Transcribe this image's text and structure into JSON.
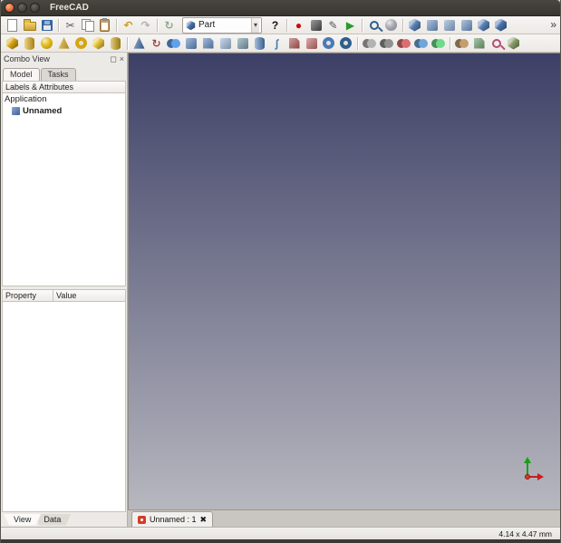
{
  "window": {
    "title": "FreeCAD"
  },
  "colors": {
    "chrome": "#d6d2cd",
    "viewport_top": "#3d4066",
    "viewport_bottom": "#b7b7bf",
    "axis_x": "#c81e1e",
    "axis_y": "#18a018"
  },
  "icons": {
    "caret": "▾",
    "overflow": "»",
    "panel_float": "◻",
    "panel_close": "×",
    "tab_close": "✖"
  },
  "toolbar_main": {
    "left_items": [
      {
        "name": "new-document",
        "kind": "page"
      },
      {
        "name": "open-document",
        "kind": "folder"
      },
      {
        "name": "save-document",
        "kind": "disk"
      },
      {
        "kind": "sep"
      },
      {
        "name": "cut",
        "kind": "glyph",
        "glyph": "✂",
        "color": "#5f5f5f"
      },
      {
        "name": "copy",
        "kind": "copy"
      },
      {
        "name": "paste",
        "kind": "clip"
      },
      {
        "kind": "sep"
      },
      {
        "name": "undo",
        "kind": "glyph",
        "glyph": "↶",
        "color": "#c79a1f",
        "bold": true
      },
      {
        "name": "redo",
        "kind": "glyph",
        "glyph": "↷",
        "color": "#b3afa9",
        "bold": true
      },
      {
        "kind": "sep"
      },
      {
        "name": "refresh",
        "kind": "glyph",
        "glyph": "↻",
        "color": "#8fa58f",
        "bold": true
      }
    ],
    "workbench_selector": {
      "value": "Part"
    },
    "right_items": [
      {
        "name": "whats-this",
        "kind": "glyph",
        "glyph": "?",
        "color": "#111111",
        "bold": true
      },
      {
        "kind": "sep"
      },
      {
        "name": "macro-record",
        "kind": "glyph",
        "glyph": "●",
        "color": "#c01010"
      },
      {
        "name": "macro-stop",
        "kind": "sq",
        "color": "#4a4a4a"
      },
      {
        "name": "macro-edit",
        "kind": "glyph",
        "glyph": "✎",
        "color": "#555555"
      },
      {
        "name": "macro-execute",
        "kind": "glyph",
        "glyph": "▶",
        "color": "#2a9a2a"
      },
      {
        "kind": "sep"
      },
      {
        "name": "zoom-fit-all",
        "kind": "zoom",
        "color": "#2e5f8a"
      },
      {
        "name": "draw-style",
        "kind": "sph",
        "color": "#a8a8b2"
      },
      {
        "kind": "sep"
      },
      {
        "name": "view-isometric",
        "kind": "cube",
        "color": "#5b82b8"
      },
      {
        "name": "view-front",
        "kind": "sq",
        "color": "#6f94c4"
      },
      {
        "name": "view-top",
        "kind": "sq",
        "color": "#87a8d0"
      },
      {
        "name": "view-right",
        "kind": "sq",
        "color": "#6f94c4"
      },
      {
        "name": "view-rear",
        "kind": "cube",
        "color": "#5b82b8"
      },
      {
        "name": "view-axonometric",
        "kind": "cube",
        "color": "#4a74ae"
      }
    ]
  },
  "toolbar_part": {
    "items": [
      {
        "name": "part-box",
        "kind": "cube",
        "color": "#d7a511"
      },
      {
        "name": "part-cylinder",
        "kind": "cyl",
        "color": "#d7a511"
      },
      {
        "name": "part-sphere",
        "kind": "sph",
        "color": "#e3b917"
      },
      {
        "name": "part-cone",
        "kind": "cone",
        "color": "#d7a511"
      },
      {
        "name": "part-torus",
        "kind": "ring",
        "color": "#d7a511"
      },
      {
        "name": "part-primitives",
        "kind": "cube",
        "color": "#e8c53c"
      },
      {
        "name": "part-shape-builder",
        "kind": "cyl",
        "color": "#c49a0c"
      },
      {
        "kind": "sep"
      },
      {
        "name": "part-extrude",
        "kind": "cone",
        "color": "#3465a4"
      },
      {
        "name": "part-revolve",
        "kind": "glyph",
        "glyph": "↻",
        "color": "#a04545",
        "bold": true
      },
      {
        "name": "part-mirror",
        "kind": "dual",
        "color": "#4a7ab5"
      },
      {
        "name": "part-fillet",
        "kind": "sq",
        "color": "#5a86c0"
      },
      {
        "name": "part-chamfer",
        "kind": "cham",
        "color": "#5a86c0"
      },
      {
        "name": "part-make-face",
        "kind": "sq",
        "color": "#9db8d9"
      },
      {
        "name": "part-ruled-surface",
        "kind": "sq",
        "color": "#7799aa"
      },
      {
        "name": "part-loft",
        "kind": "cyl",
        "color": "#4a7ab5"
      },
      {
        "name": "part-sweep",
        "kind": "glyph",
        "glyph": "∫",
        "color": "#4a7ab5",
        "bold": true
      },
      {
        "name": "part-section",
        "kind": "cham",
        "color": "#b05050"
      },
      {
        "name": "part-cross-sections",
        "kind": "sq",
        "color": "#c06868"
      },
      {
        "name": "part-offset",
        "kind": "ring",
        "color": "#4a7ab5"
      },
      {
        "name": "part-thickness",
        "kind": "ring",
        "color": "#2e5f8a"
      },
      {
        "kind": "sep"
      },
      {
        "name": "part-compound",
        "kind": "dual",
        "color": "#8a8a8a"
      },
      {
        "name": "part-boolean",
        "kind": "dual",
        "color": "#6f6f6f"
      },
      {
        "name": "part-cut",
        "kind": "dual",
        "color": "#a85555"
      },
      {
        "name": "part-union",
        "kind": "dual",
        "color": "#5580a8"
      },
      {
        "name": "part-intersection",
        "kind": "dual",
        "color": "#55a86a"
      },
      {
        "kind": "sep"
      },
      {
        "name": "part-connect",
        "kind": "dual",
        "color": "#967a55"
      },
      {
        "name": "part-split",
        "kind": "cham",
        "color": "#6a9a6a"
      },
      {
        "name": "part-check-geometry",
        "kind": "zoom",
        "color": "#b05070"
      },
      {
        "name": "part-defeaturing",
        "kind": "cube",
        "color": "#8aa06a"
      }
    ]
  },
  "combo_view": {
    "title": "Combo View",
    "tabs": [
      {
        "label": "Model"
      },
      {
        "label": "Tasks"
      }
    ],
    "tree_header": "Labels & Attributes",
    "tree": {
      "root": "Application",
      "document": "Unnamed"
    },
    "property_columns": [
      "Property",
      "Value"
    ],
    "bottom_tabs": [
      {
        "label": "View"
      },
      {
        "label": "Data"
      }
    ]
  },
  "document_tab": {
    "label": "Unnamed : 1"
  },
  "status_bar": {
    "dimensions": "4.14 x 4.47 mm"
  }
}
